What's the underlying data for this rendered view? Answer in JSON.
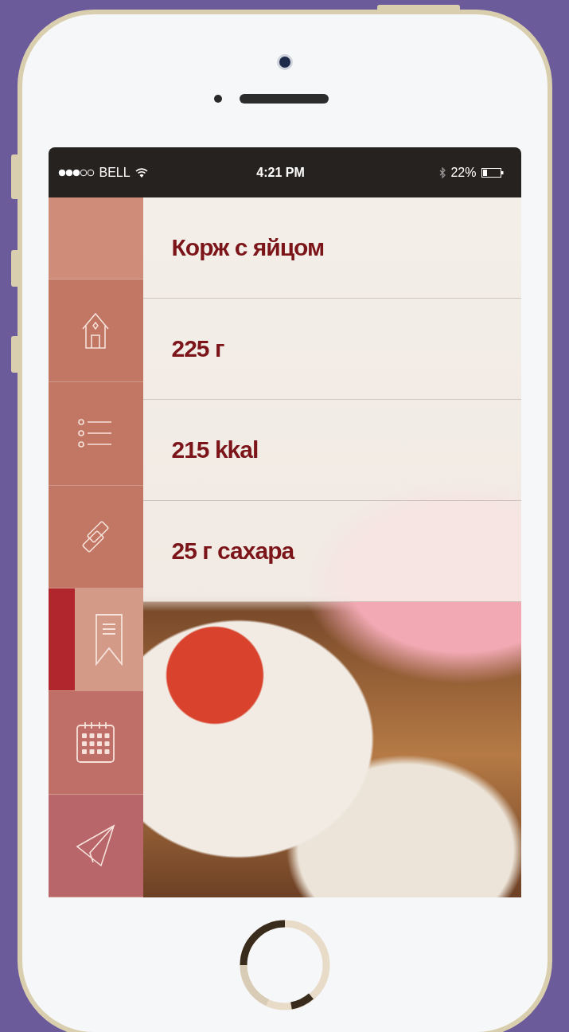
{
  "status_bar": {
    "carrier": "BELL",
    "time": "4:21 PM",
    "battery": "22%"
  },
  "sidebar": {
    "items": [
      {
        "kind": "home",
        "selected": false
      },
      {
        "kind": "list",
        "selected": false
      },
      {
        "kind": "link",
        "selected": false
      },
      {
        "kind": "bookmark",
        "selected": true
      },
      {
        "kind": "calendar",
        "selected": false
      },
      {
        "kind": "send",
        "selected": false
      }
    ]
  },
  "details": [
    {
      "text": "Корж с яйцом"
    },
    {
      "text": "225 г"
    },
    {
      "text": "215 kkal"
    },
    {
      "text": "25 г сахара"
    }
  ]
}
